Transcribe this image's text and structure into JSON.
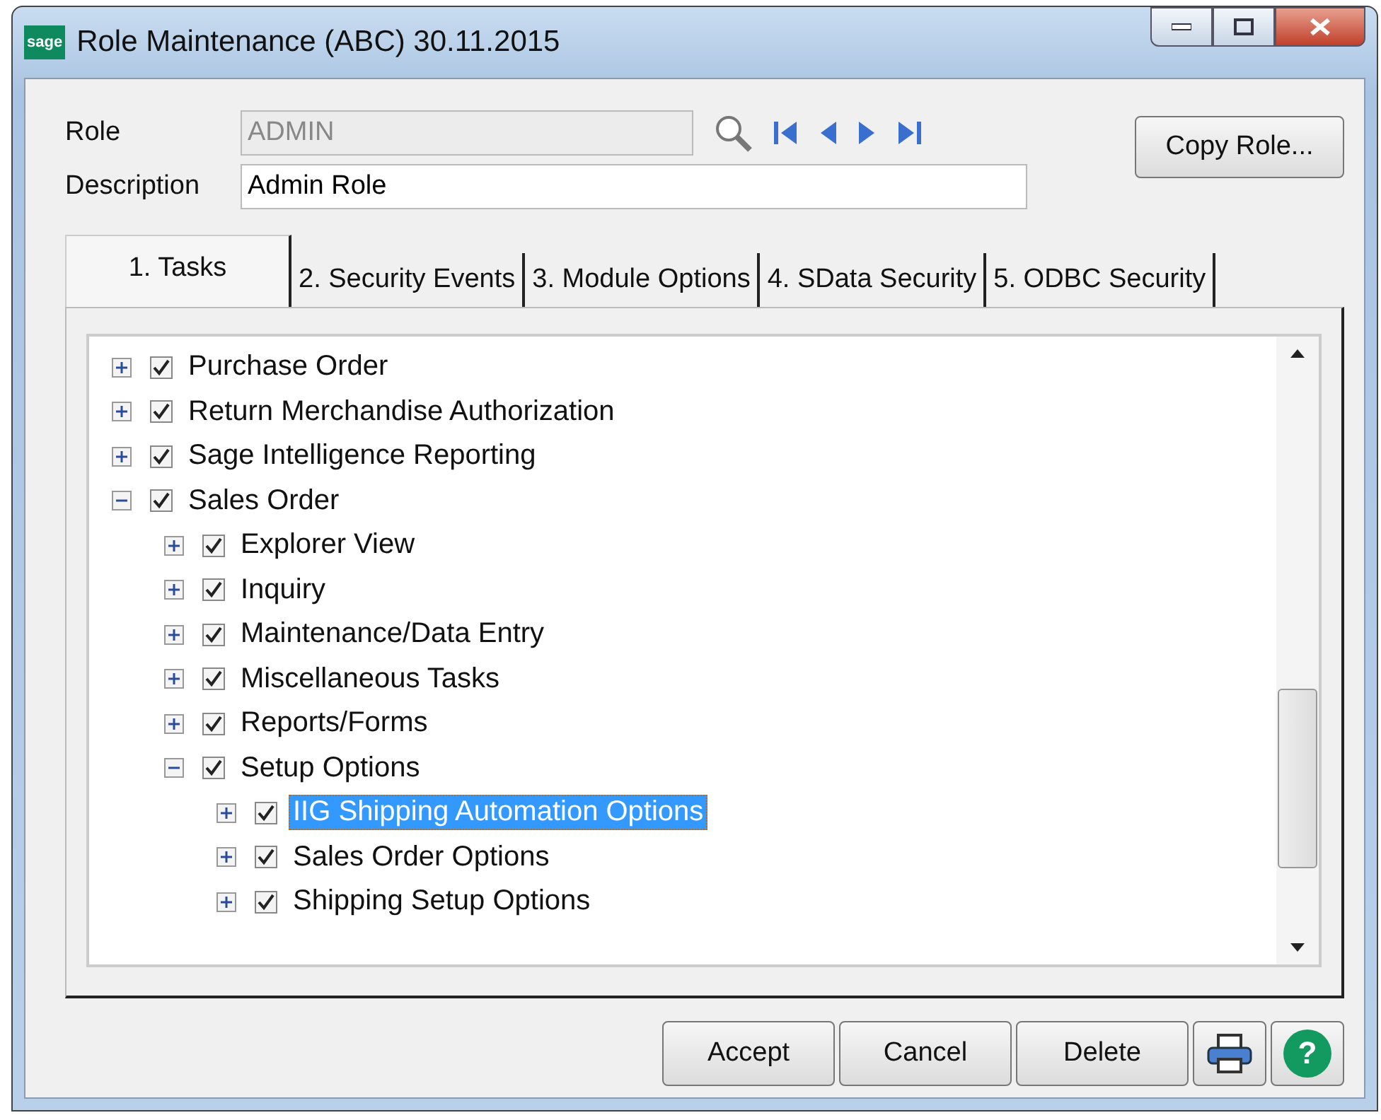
{
  "window": {
    "title": "Role Maintenance (ABC) 30.11.2015",
    "logo": "sage"
  },
  "form": {
    "role_label": "Role",
    "role_value": "ADMIN",
    "description_label": "Description",
    "description_value": "Admin Role",
    "copy_button": "Copy Role..."
  },
  "tabs": [
    {
      "label": "1. Tasks",
      "selected": true
    },
    {
      "label": "2. Security Events",
      "selected": false
    },
    {
      "label": "3. Module Options",
      "selected": false
    },
    {
      "label": "4. SData Security",
      "selected": false
    },
    {
      "label": "5. ODBC Security",
      "selected": false
    }
  ],
  "tree": [
    {
      "label": "Purchase Order",
      "checked": true,
      "expanded": false,
      "selected": false
    },
    {
      "label": "Return Merchandise Authorization",
      "checked": true,
      "expanded": false,
      "selected": false
    },
    {
      "label": "Sage Intelligence Reporting",
      "checked": true,
      "expanded": false,
      "selected": false
    },
    {
      "label": "Sales Order",
      "checked": true,
      "expanded": true,
      "selected": false,
      "children": [
        {
          "label": "Explorer View",
          "checked": true,
          "expanded": false,
          "selected": false
        },
        {
          "label": "Inquiry",
          "checked": true,
          "expanded": false,
          "selected": false
        },
        {
          "label": "Maintenance/Data Entry",
          "checked": true,
          "expanded": false,
          "selected": false
        },
        {
          "label": "Miscellaneous Tasks",
          "checked": true,
          "expanded": false,
          "selected": false
        },
        {
          "label": "Reports/Forms",
          "checked": true,
          "expanded": false,
          "selected": false
        },
        {
          "label": "Setup Options",
          "checked": true,
          "expanded": true,
          "selected": false,
          "children": [
            {
              "label": "IIG Shipping Automation Options",
              "checked": true,
              "expanded": false,
              "selected": true
            },
            {
              "label": "Sales Order Options",
              "checked": true,
              "expanded": false,
              "selected": false
            },
            {
              "label": "Shipping Setup Options",
              "checked": true,
              "expanded": false,
              "selected": false
            }
          ]
        }
      ]
    }
  ],
  "buttons": [
    "Accept",
    "Cancel",
    "Delete"
  ],
  "help_glyph": "?"
}
